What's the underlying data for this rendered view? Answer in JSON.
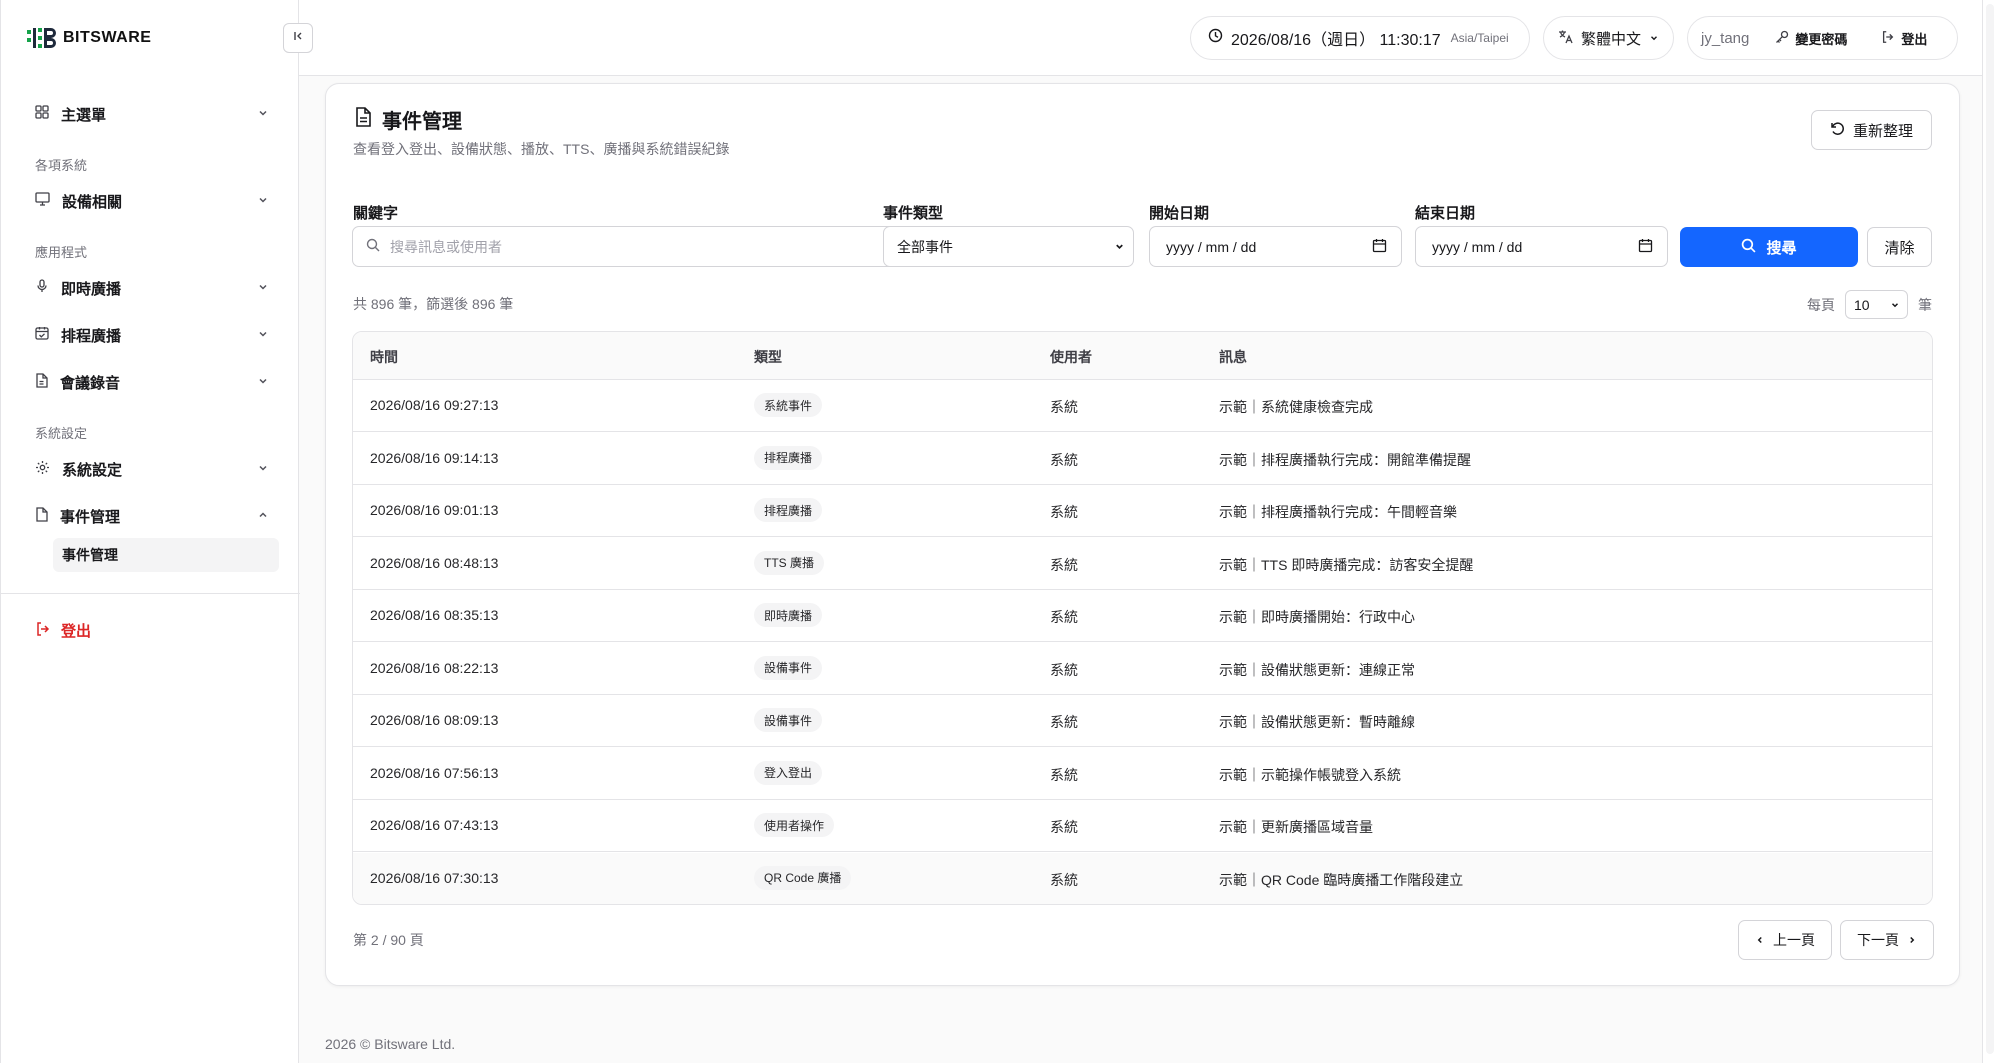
{
  "brand": {
    "name": "BITSWARE"
  },
  "sidebar": {
    "main_menu": "主選單",
    "group_systems": "各項系統",
    "devices": "設備相關",
    "group_apps": "應用程式",
    "live_broadcast": "即時廣播",
    "scheduled_broadcast": "排程廣播",
    "meeting_recording": "會議錄音",
    "group_settings": "系統設定",
    "system_settings": "系統設定",
    "event_management": "事件管理",
    "event_management_sub": "事件管理",
    "logout": "登出"
  },
  "topbar": {
    "datetime": "2026/08/16（週日） 11:30:17",
    "timezone": "Asia/Taipei",
    "language": "繁體中文",
    "username": "jy_tang",
    "change_password": "變更密碼",
    "logout": "登出"
  },
  "page": {
    "title": "事件管理",
    "subtitle": "查看登入登出、設備狀態、播放、TTS、廣播與系統錯誤紀錄",
    "refresh": "重新整理"
  },
  "filters": {
    "keyword_label": "關鍵字",
    "keyword_placeholder": "搜尋訊息或使用者",
    "type_label": "事件類型",
    "type_value": "全部事件",
    "start_label": "開始日期",
    "start_value": "yyyy / mm / dd",
    "end_label": "結束日期",
    "end_value": "yyyy / mm / dd",
    "search": "搜尋",
    "clear": "清除"
  },
  "summary": {
    "count_text": "共 896 筆，篩選後 896 筆",
    "per_page_label": "每頁",
    "per_page_value": "10",
    "per_page_unit": "筆"
  },
  "table": {
    "headers": {
      "time": "時間",
      "type": "類型",
      "user": "使用者",
      "message": "訊息"
    },
    "rows": [
      {
        "time": "2026/08/16 09:27:13",
        "type": "系統事件",
        "user": "系統",
        "message": "示範｜系統健康檢查完成"
      },
      {
        "time": "2026/08/16 09:14:13",
        "type": "排程廣播",
        "user": "系統",
        "message": "示範｜排程廣播執行完成：開館準備提醒"
      },
      {
        "time": "2026/08/16 09:01:13",
        "type": "排程廣播",
        "user": "系統",
        "message": "示範｜排程廣播執行完成：午間輕音樂"
      },
      {
        "time": "2026/08/16 08:48:13",
        "type": "TTS 廣播",
        "user": "系統",
        "message": "示範｜TTS 即時廣播完成：訪客安全提醒"
      },
      {
        "time": "2026/08/16 08:35:13",
        "type": "即時廣播",
        "user": "系統",
        "message": "示範｜即時廣播開始：行政中心"
      },
      {
        "time": "2026/08/16 08:22:13",
        "type": "設備事件",
        "user": "系統",
        "message": "示範｜設備狀態更新：連線正常"
      },
      {
        "time": "2026/08/16 08:09:13",
        "type": "設備事件",
        "user": "系統",
        "message": "示範｜設備狀態更新：暫時離線"
      },
      {
        "time": "2026/08/16 07:56:13",
        "type": "登入登出",
        "user": "系統",
        "message": "示範｜示範操作帳號登入系統"
      },
      {
        "time": "2026/08/16 07:43:13",
        "type": "使用者操作",
        "user": "系統",
        "message": "示範｜更新廣播區域音量"
      },
      {
        "time": "2026/08/16 07:30:13",
        "type": "QR Code 廣播",
        "user": "系統",
        "message": "示範｜QR Code 臨時廣播工作階段建立"
      }
    ]
  },
  "pagination": {
    "info": "第 2 / 90 頁",
    "prev": "上一頁",
    "next": "下一頁"
  },
  "footer": {
    "text": "2026 © Bitsware Ltd."
  },
  "colors": {
    "primary": "#1466ff",
    "danger": "#dc2626",
    "brand_green": "#16a34a"
  }
}
